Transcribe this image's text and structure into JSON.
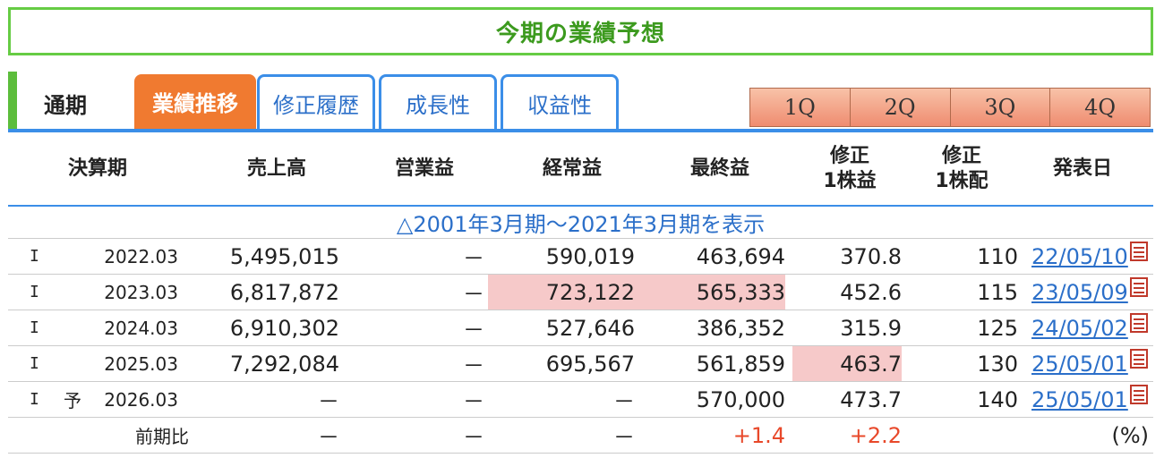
{
  "title": "今期の業績予想",
  "tabs": {
    "static_label": "通期",
    "items": [
      {
        "label": "業績推移",
        "active": true
      },
      {
        "label": "修正履歴",
        "active": false
      },
      {
        "label": "成長性",
        "active": false
      },
      {
        "label": "収益性",
        "active": false
      }
    ],
    "quarters": [
      "1Q",
      "2Q",
      "3Q",
      "4Q"
    ]
  },
  "table": {
    "headers": {
      "period": "決算期",
      "sales": "売上高",
      "operating": "営業益",
      "ordinary": "経常益",
      "net": "最終益",
      "eps_l1": "修正",
      "eps_l2": "1株益",
      "div_l1": "修正",
      "div_l2": "1株配",
      "date": "発表日"
    },
    "expand_link": "△2001年3月期～2021年3月期を表示",
    "rows": [
      {
        "mark": "I",
        "forecast": "",
        "period": "2022.03",
        "sales": "5,495,015",
        "operating": "－",
        "ordinary": "590,019",
        "net": "463,694",
        "eps": "370.8",
        "div": "110",
        "date": "22/05/10"
      },
      {
        "mark": "I",
        "forecast": "",
        "period": "2023.03",
        "sales": "6,817,872",
        "operating": "－",
        "ordinary": "723,122",
        "net": "565,333",
        "eps": "452.6",
        "div": "115",
        "date": "23/05/09"
      },
      {
        "mark": "I",
        "forecast": "",
        "period": "2024.03",
        "sales": "6,910,302",
        "operating": "－",
        "ordinary": "527,646",
        "net": "386,352",
        "eps": "315.9",
        "div": "125",
        "date": "24/05/02"
      },
      {
        "mark": "I",
        "forecast": "",
        "period": "2025.03",
        "sales": "7,292,084",
        "operating": "－",
        "ordinary": "695,567",
        "net": "561,859",
        "eps": "463.7",
        "div": "130",
        "date": "25/05/01"
      },
      {
        "mark": "I",
        "forecast": "予",
        "period": "2026.03",
        "sales": "－",
        "operating": "－",
        "ordinary": "－",
        "net": "570,000",
        "eps": "473.7",
        "div": "140",
        "date": "25/05/01"
      }
    ],
    "compare": {
      "label": "前期比",
      "sales": "－",
      "operating": "－",
      "ordinary": "－",
      "net": "+1.4",
      "eps": "+2.2",
      "unit": "(%)"
    }
  },
  "colors": {
    "title_green": "#3c9a1e",
    "tab_orange": "#f07a30",
    "link_blue": "#2b6fc9",
    "highlight_pink": "#f6c9c9",
    "positive_red": "#e8482a"
  }
}
